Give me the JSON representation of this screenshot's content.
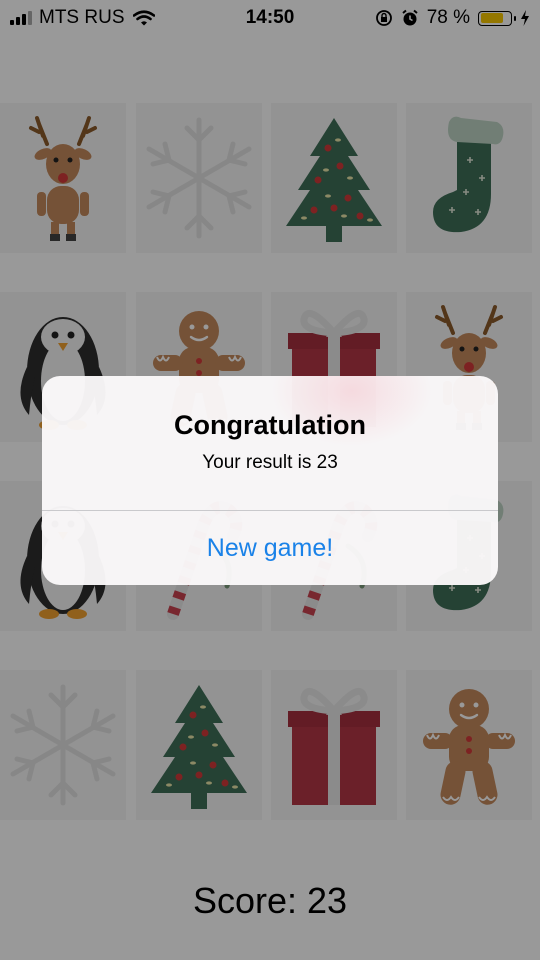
{
  "status_bar": {
    "carrier": "MTS RUS",
    "time": "14:50",
    "battery_percent": "78 %",
    "battery_level": 0.78,
    "icons": [
      "signal-bars-icon",
      "wifi-icon",
      "orientation-lock-icon",
      "alarm-icon",
      "battery-icon",
      "charging-bolt-icon"
    ]
  },
  "board": {
    "cards": [
      {
        "icon": "reindeer"
      },
      {
        "icon": "snowflake"
      },
      {
        "icon": "christmas-tree"
      },
      {
        "icon": "stocking"
      },
      {
        "icon": "penguin"
      },
      {
        "icon": "gingerbread-man"
      },
      {
        "icon": "gift-box"
      },
      {
        "icon": "reindeer"
      },
      {
        "icon": "penguin"
      },
      {
        "icon": "candy-cane"
      },
      {
        "icon": "candy-cane"
      },
      {
        "icon": "stocking"
      },
      {
        "icon": "snowflake"
      },
      {
        "icon": "christmas-tree"
      },
      {
        "icon": "gift-box"
      },
      {
        "icon": "gingerbread-man"
      }
    ]
  },
  "score": {
    "text": "Score: 23"
  },
  "alert": {
    "title": "Congratulation",
    "message": "Your result is 23",
    "button_label": "New game!"
  },
  "colors": {
    "accent": "#1a82e8",
    "card_background": "#f5f5f5",
    "battery": "#f7c600"
  }
}
